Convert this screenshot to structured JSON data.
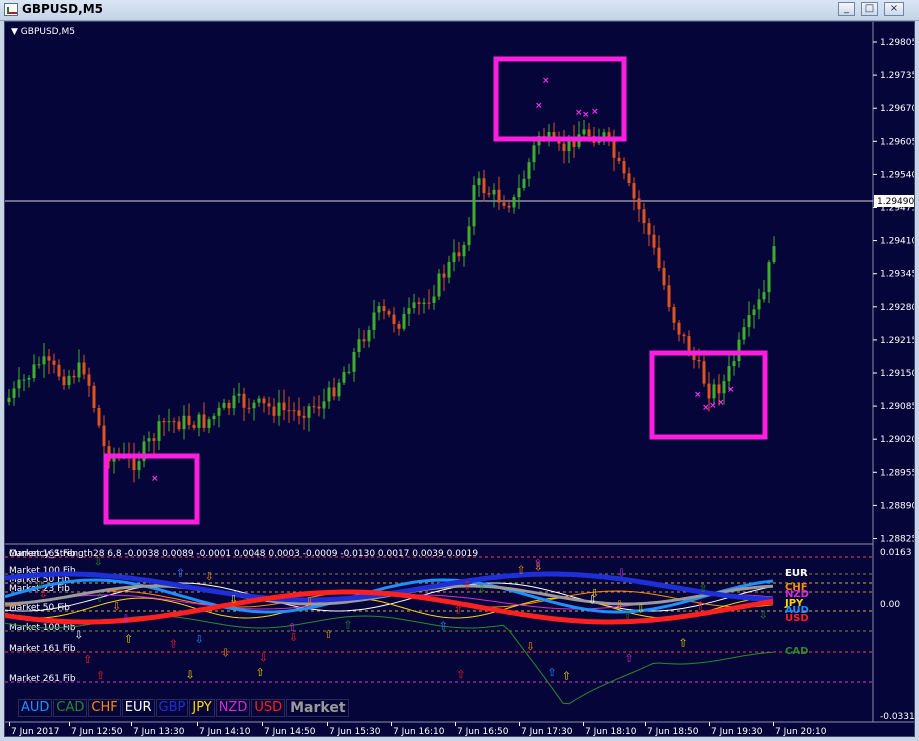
{
  "window": {
    "title": "GBPUSD,M5",
    "buttons": [
      "_",
      "□",
      "×"
    ]
  },
  "chart": {
    "label": "GBPUSD,M5",
    "current_price": "1.29490",
    "price_levels": [
      "1.29805",
      "1.29735",
      "1.29670",
      "1.29605",
      "1.29540",
      "1.29475",
      "1.29410",
      "1.29345",
      "1.29280",
      "1.29215",
      "1.29150",
      "1.29085",
      "1.29020",
      "1.28955",
      "1.28890",
      "1.28825"
    ],
    "dates": [
      "7 Jun 2017",
      "7 Jun 12:50",
      "7 Jun 13:30",
      "7 Jun 14:10",
      "7 Jun 14:50",
      "7 Jun 15:30",
      "7 Jun 16:10",
      "7 Jun 16:50",
      "7 Jun 17:30",
      "7 Jun 18:10",
      "7 Jun 18:50",
      "7 Jun 19:30",
      "7 Jun 20:10"
    ],
    "colors": {
      "background": "#05053a",
      "bull": "#3fae2a",
      "bear": "#e0521e",
      "highlight": "#ff1ee0"
    }
  },
  "indicator": {
    "header": "Currency_Strength28 6.8 -0.0038 0.0089 -0.0001 0.0048 0.0003 -0.0009 -0.0130 0.0017 0.0039 0.0019",
    "scale": [
      "0.0163",
      "0.00",
      "-0.0331"
    ],
    "levels": [
      "Market 161 Fib",
      "Market 100 Fib",
      "Market 50 Fib",
      "Market 23 Fib",
      "Market 50 Fib",
      "Market 100 Fib",
      "Market 161 Fib",
      "Market 261 Fib"
    ],
    "right_labels": [
      "EUR",
      "CHF",
      "NZD",
      "JPY",
      "AUD",
      "USD",
      "CAD"
    ],
    "legend": [
      {
        "name": "AUD",
        "color": "#1e90ff"
      },
      {
        "name": "CAD",
        "color": "#2a8a2a"
      },
      {
        "name": "CHF",
        "color": "#ff8c00"
      },
      {
        "name": "EUR",
        "color": "#ffffff"
      },
      {
        "name": "GBP",
        "color": "#1f2fd8"
      },
      {
        "name": "JPY",
        "color": "#ffd700"
      },
      {
        "name": "NZD",
        "color": "#d02fd0"
      },
      {
        "name": "USD",
        "color": "#ff2020"
      },
      {
        "name": "Market",
        "color": "#9a9a9a"
      }
    ]
  }
}
